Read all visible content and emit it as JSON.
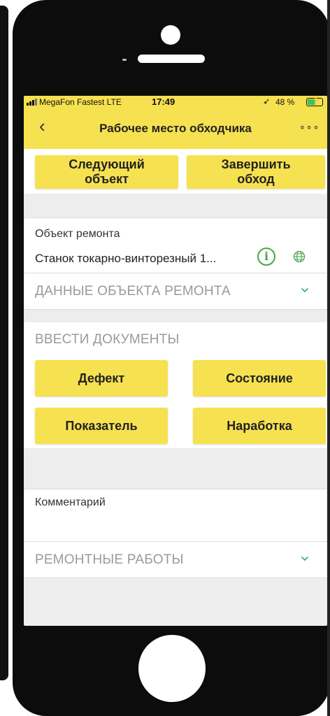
{
  "status_bar": {
    "carrier": "MegaFon Fastest  LTE",
    "time": "17:49",
    "battery": "48 %"
  },
  "nav": {
    "title": "Рабочее место обходчика",
    "back_icon": "chevron-left-icon",
    "menu_icon": "more-dots-icon"
  },
  "top_actions": {
    "next_line1": "Следующий",
    "next_line2": "объект",
    "finish_line1": "Завершить",
    "finish_line2": "обход"
  },
  "object": {
    "label": "Объект ремонта",
    "value": "Станок токарно-винторезный 1...",
    "info_icon": "info-icon",
    "globe_icon": "globe-icon"
  },
  "object_data_header": "ДАННЫЕ ОБЪЕКТА РЕМОНТА",
  "documents": {
    "title": "ВВЕСТИ ДОКУМЕНТЫ",
    "defect": "Дефект",
    "state": "Состояние",
    "indicator": "Показатель",
    "operating_time": "Наработка"
  },
  "comment_label": "Комментарий",
  "repair_works_header": "РЕМОНТНЫЕ РАБОТЫ",
  "colors": {
    "accent": "#f6e150",
    "icon_green": "#49a54a"
  }
}
